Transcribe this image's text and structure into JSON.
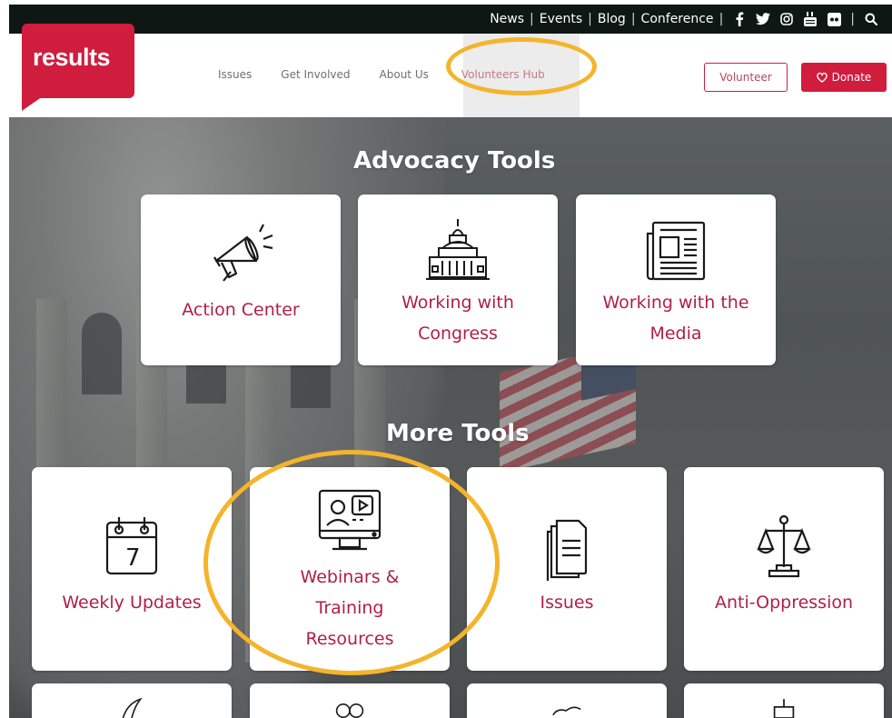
{
  "topbar": {
    "links": [
      "News",
      "Events",
      "Blog",
      "Conference"
    ],
    "social_icons": [
      "facebook-icon",
      "twitter-icon",
      "instagram-icon",
      "youtube-icon",
      "flickr-icon"
    ],
    "search_icon": "search-icon"
  },
  "header": {
    "logo_text": "results",
    "nav": [
      "Issues",
      "Get Involved",
      "About Us",
      "Volunteers Hub"
    ],
    "volunteer_label": "Volunteer",
    "donate_label": "Donate",
    "donate_icon": "heart-icon"
  },
  "advocacy": {
    "title": "Advocacy Tools",
    "cards": [
      {
        "label": "Action Center",
        "icon": "megaphone-icon"
      },
      {
        "label": "Working with Congress",
        "icon": "capitol-icon"
      },
      {
        "label": "Working with the Media",
        "icon": "newspaper-icon"
      }
    ]
  },
  "more": {
    "title": "More Tools",
    "cards": [
      {
        "label": "Weekly Updates",
        "icon": "calendar-icon",
        "icon_number": "7"
      },
      {
        "label": "Webinars & Training Resources",
        "icon": "webinar-monitor-icon"
      },
      {
        "label": "Issues",
        "icon": "documents-icon"
      },
      {
        "label": "Anti-Oppression",
        "icon": "scales-icon"
      }
    ]
  },
  "colors": {
    "brand_red": "#d01c3d",
    "card_text": "#b01f45",
    "annotation": "#f4b42b",
    "topbar_bg": "#0e1714"
  }
}
